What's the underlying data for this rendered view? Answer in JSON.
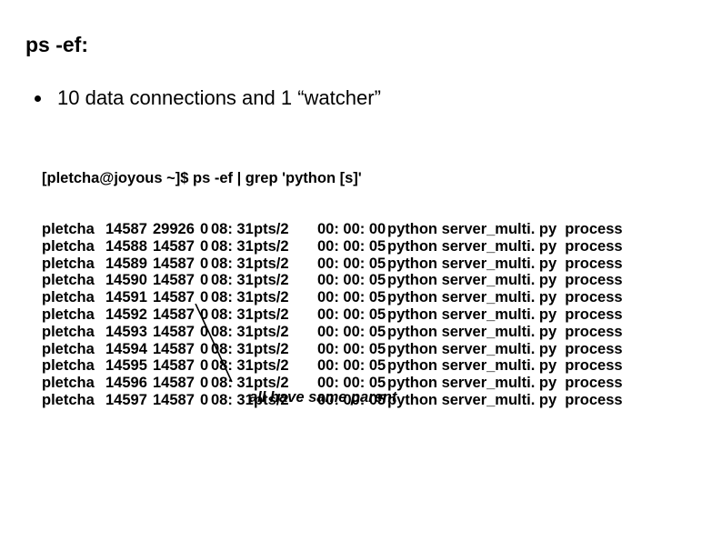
{
  "title": "ps -ef:",
  "bullet": "10 data connections and 1 “watcher”",
  "command_line": "[pletcha@joyous ~]$ ps -ef | grep 'python [s]'",
  "annotation": "all have same parent",
  "rows": [
    {
      "uid": "pletcha",
      "pid": "14587",
      "ppid": "29926",
      "c": "0",
      "stime": "08: 31",
      "tty": "pts/2",
      "time": "00: 00: 00",
      "cmd": "python server_multi. py  process"
    },
    {
      "uid": "pletcha",
      "pid": "14588",
      "ppid": "14587",
      "c": "0",
      "stime": "08: 31",
      "tty": "pts/2",
      "time": "00: 00: 05",
      "cmd": "python server_multi. py  process"
    },
    {
      "uid": "pletcha",
      "pid": "14589",
      "ppid": "14587",
      "c": "0",
      "stime": "08: 31",
      "tty": "pts/2",
      "time": "00: 00: 05",
      "cmd": "python server_multi. py  process"
    },
    {
      "uid": "pletcha",
      "pid": "14590",
      "ppid": "14587",
      "c": "0",
      "stime": "08: 31",
      "tty": "pts/2",
      "time": "00: 00: 05",
      "cmd": "python server_multi. py  process"
    },
    {
      "uid": "pletcha",
      "pid": "14591",
      "ppid": "14587",
      "c": "0",
      "stime": "08: 31",
      "tty": "pts/2",
      "time": "00: 00: 05",
      "cmd": "python server_multi. py  process"
    },
    {
      "uid": "pletcha",
      "pid": "14592",
      "ppid": "14587",
      "c": "0",
      "stime": "08: 31",
      "tty": "pts/2",
      "time": "00: 00: 05",
      "cmd": "python server_multi. py  process"
    },
    {
      "uid": "pletcha",
      "pid": "14593",
      "ppid": "14587",
      "c": "0",
      "stime": "08: 31",
      "tty": "pts/2",
      "time": "00: 00: 05",
      "cmd": "python server_multi. py  process"
    },
    {
      "uid": "pletcha",
      "pid": "14594",
      "ppid": "14587",
      "c": "0",
      "stime": "08: 31",
      "tty": "pts/2",
      "time": "00: 00: 05",
      "cmd": "python server_multi. py  process"
    },
    {
      "uid": "pletcha",
      "pid": "14595",
      "ppid": "14587",
      "c": "0",
      "stime": "08: 31",
      "tty": "pts/2",
      "time": "00: 00: 05",
      "cmd": "python server_multi. py  process"
    },
    {
      "uid": "pletcha",
      "pid": "14596",
      "ppid": "14587",
      "c": "0",
      "stime": "08: 31",
      "tty": "pts/2",
      "time": "00: 00: 05",
      "cmd": "python server_multi. py  process"
    },
    {
      "uid": "pletcha",
      "pid": "14597",
      "ppid": "14587",
      "c": "0",
      "stime": "08: 31",
      "tty": "pts/2",
      "time": "00: 00: 05",
      "cmd": "python server_multi. py  process"
    }
  ]
}
